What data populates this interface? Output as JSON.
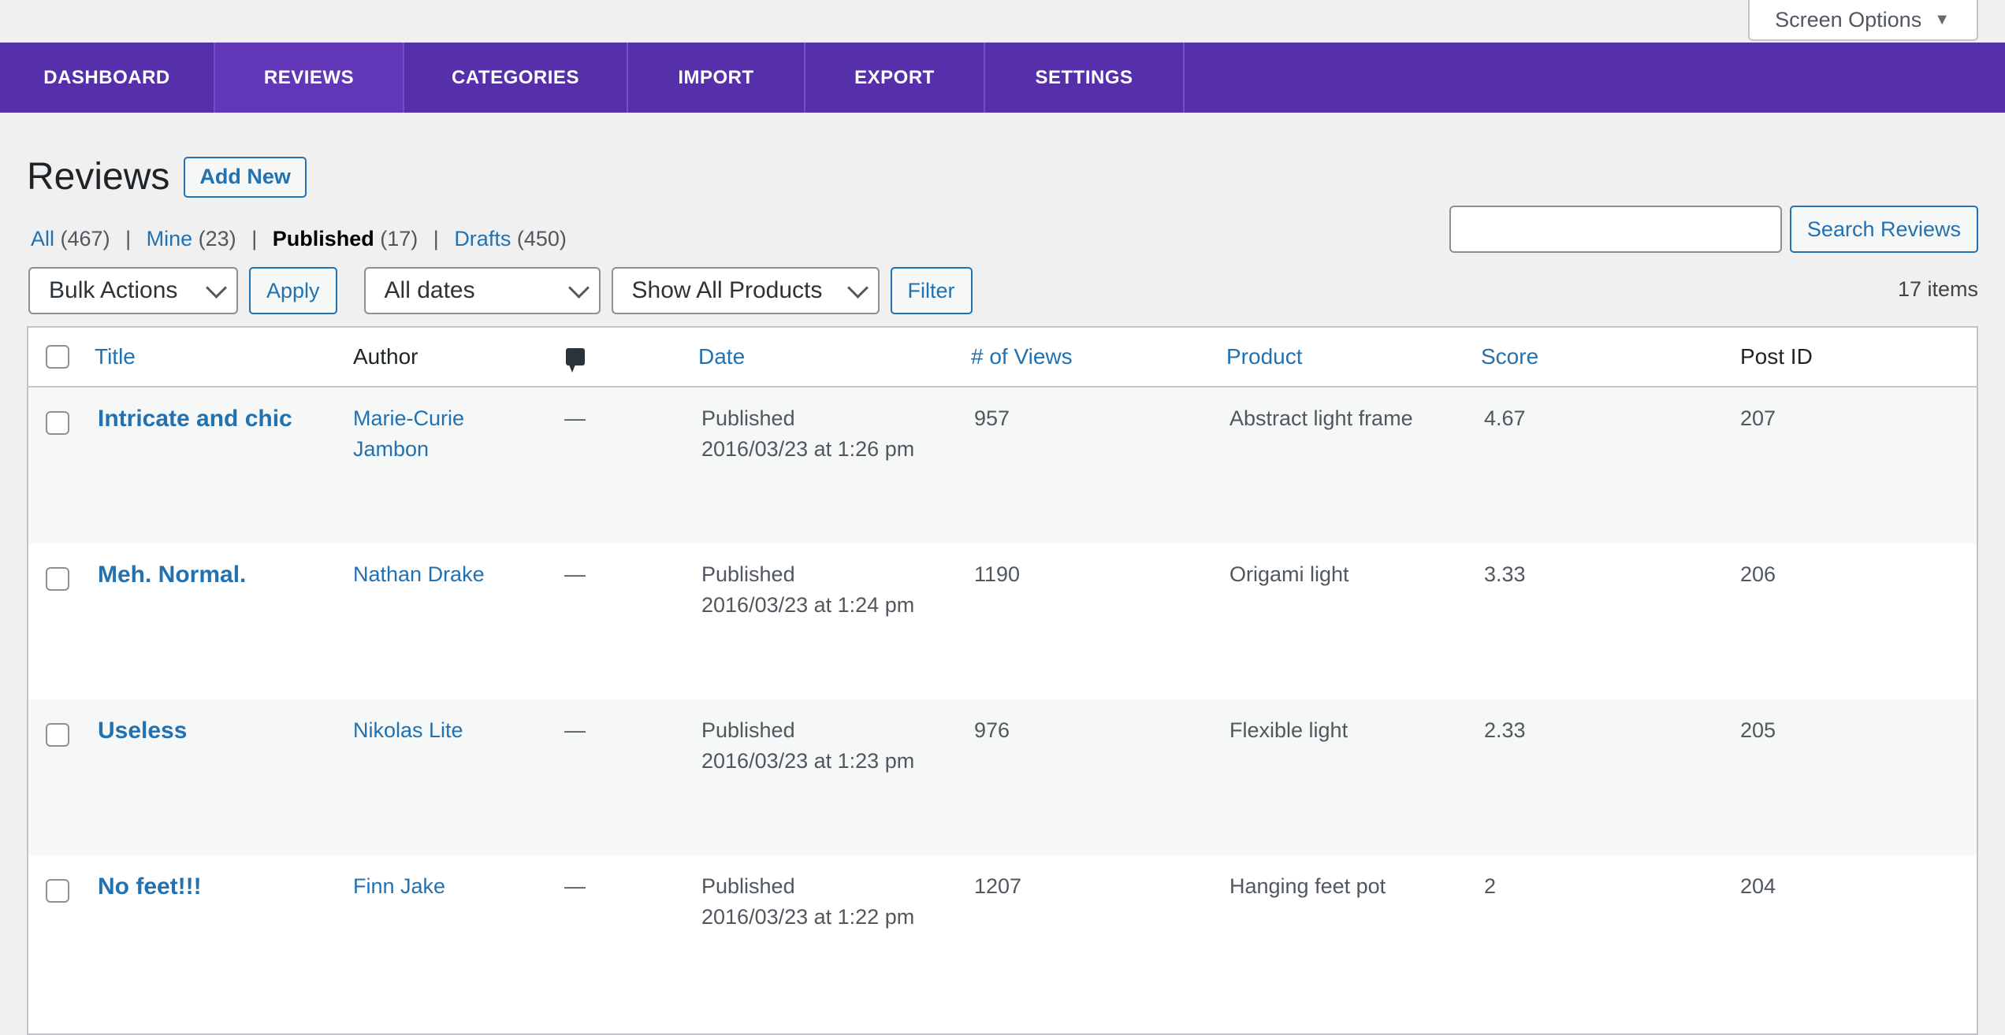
{
  "screen_options": {
    "label": "Screen Options",
    "arrow": "▼"
  },
  "nav": {
    "tabs": [
      {
        "label": "DASHBOARD",
        "active": false
      },
      {
        "label": "REVIEWS",
        "active": true
      },
      {
        "label": "CATEGORIES",
        "active": false
      },
      {
        "label": "IMPORT",
        "active": false
      },
      {
        "label": "EXPORT",
        "active": false
      },
      {
        "label": "SETTINGS",
        "active": false
      }
    ]
  },
  "page": {
    "title": "Reviews",
    "add_new_label": "Add New"
  },
  "filters": {
    "all": {
      "label": "All",
      "count": "(467)"
    },
    "mine": {
      "label": "Mine",
      "count": "(23)"
    },
    "published": {
      "label": "Published",
      "count": "(17)"
    },
    "drafts": {
      "label": "Drafts",
      "count": "(450)"
    },
    "separator": "|"
  },
  "search": {
    "value": "",
    "placeholder": "",
    "button_label": "Search Reviews"
  },
  "tablenav": {
    "bulk_actions": "Bulk Actions",
    "apply_label": "Apply",
    "dates": "All dates",
    "products": "Show All Products",
    "filter_label": "Filter",
    "items_count": "17 items"
  },
  "table": {
    "columns": {
      "title": "Title",
      "author": "Author",
      "comments_icon": "comment-icon",
      "date": "Date",
      "views": "# of Views",
      "product": "Product",
      "score": "Score",
      "post_id": "Post ID"
    },
    "rows": [
      {
        "title": "Intricate and chic",
        "author": "Marie-Curie Jambon",
        "comments": "—",
        "status": "Published",
        "date": "2016/03/23 at 1:26 pm",
        "views": "957",
        "product": "Abstract light frame",
        "score": "4.67",
        "post_id": "207"
      },
      {
        "title": "Meh. Normal.",
        "author": "Nathan Drake",
        "comments": "—",
        "status": "Published",
        "date": "2016/03/23 at 1:24 pm",
        "views": "1190",
        "product": "Origami light",
        "score": "3.33",
        "post_id": "206"
      },
      {
        "title": "Useless",
        "author": "Nikolas Lite",
        "comments": "—",
        "status": "Published",
        "date": "2016/03/23 at 1:23 pm",
        "views": "976",
        "product": "Flexible light",
        "score": "2.33",
        "post_id": "205"
      },
      {
        "title": "No feet!!!",
        "author": "Finn Jake",
        "comments": "—",
        "status": "Published",
        "date": "2016/03/23 at 1:22 pm",
        "views": "1207",
        "product": "Hanging feet pot",
        "score": "2",
        "post_id": "204"
      }
    ]
  }
}
